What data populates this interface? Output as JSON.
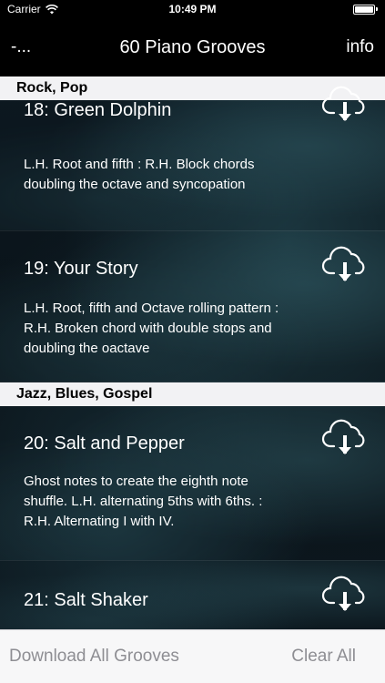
{
  "status_bar": {
    "carrier": "Carrier",
    "time": "10:49 PM",
    "battery_level": 1.0
  },
  "nav": {
    "back_label": "-...",
    "title": "60 Piano Grooves",
    "info_label": "info"
  },
  "sections": [
    {
      "header": "Rock, Pop",
      "items": [
        {
          "title": "18: Green Dolphin",
          "desc_lines": [
            "L.H. Root  and  fifth : R.H. Block chords",
            "doubling the octave and syncopation"
          ]
        },
        {
          "title": "19: Your Story",
          "desc_lines": [
            "L.H. Root, fifth and Octave rolling pattern :",
            "R.H. Broken chord with double stops and",
            "doubling the oactave"
          ]
        }
      ]
    },
    {
      "header": "Jazz, Blues, Gospel",
      "items": [
        {
          "title": "20: Salt and Pepper",
          "desc_lines": [
            "Ghost notes to create the eighth note",
            "shuffle. L.H. alternating 5ths with 6ths. :",
            "R.H. Alternating I with IV."
          ]
        },
        {
          "title": "21: Salt Shaker",
          "desc_lines": []
        }
      ]
    }
  ],
  "toolbar": {
    "download_all_label": "Download All Grooves",
    "clear_all_label": "Clear All"
  },
  "icons": {
    "download": "cloud-download-icon",
    "wifi": "wifi-icon",
    "battery": "battery-icon"
  }
}
